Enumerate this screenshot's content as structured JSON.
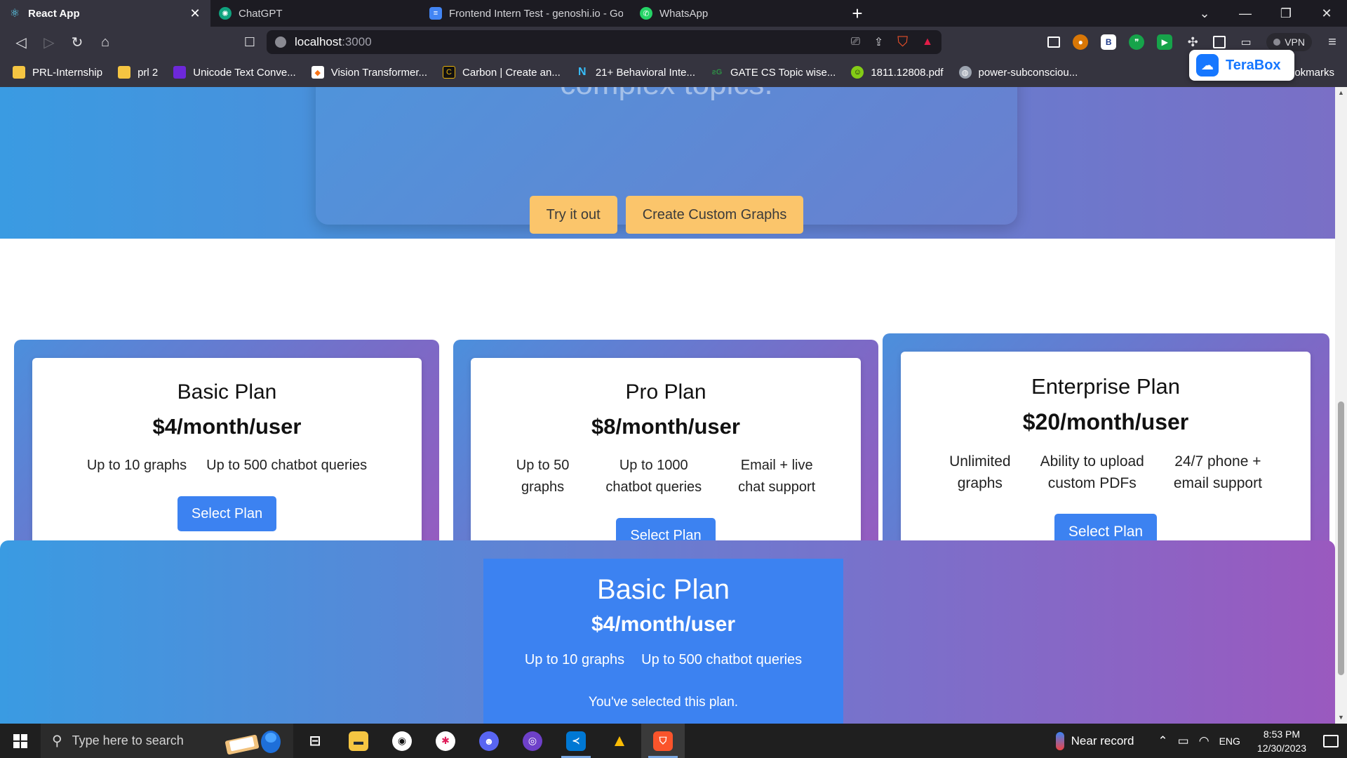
{
  "browser": {
    "tabs": [
      {
        "label": "React App",
        "icon": "react-icon",
        "color": "#61dafb",
        "active": true
      },
      {
        "label": "ChatGPT",
        "icon": "chatgpt-icon",
        "color": "#10a37f",
        "active": false
      },
      {
        "label": "Frontend Intern Test - genoshi.io - Goo",
        "icon": "google-docs-icon",
        "color": "#4285f4",
        "active": false
      },
      {
        "label": "WhatsApp",
        "icon": "whatsapp-icon",
        "color": "#25d366",
        "active": false
      }
    ],
    "url_host": "localhost",
    "url_port": ":3000",
    "vpn_label": "VPN",
    "bookmarks": [
      {
        "label": "PRL-Internship",
        "icon": "folder-icon",
        "color": "#f5c542"
      },
      {
        "label": "prl 2",
        "icon": "folder-icon",
        "color": "#f5c542"
      },
      {
        "label": "Unicode Text Conve...",
        "icon": "unicode-icon",
        "color": "#6d28d9"
      },
      {
        "label": "Vision Transformer...",
        "icon": "vision-icon",
        "color": "#f97316"
      },
      {
        "label": "Carbon | Create an...",
        "icon": "carbon-icon",
        "color": "#111111"
      },
      {
        "label": "21+ Behavioral Inte...",
        "icon": "n-icon",
        "color": "#38bdf8"
      },
      {
        "label": "GATE CS Topic wise...",
        "icon": "gfg-icon",
        "color": "#2f8d46"
      },
      {
        "label": "1811.12808.pdf",
        "icon": "pdf-icon",
        "color": "#84cc16"
      },
      {
        "label": "power-subconsciou...",
        "icon": "globe-icon",
        "color": "#9ca3af"
      }
    ],
    "bookmarks_end": "okmarks",
    "terabox_label": "TeraBox"
  },
  "hero": {
    "text": "complex topics.",
    "buttons": [
      "Try it out",
      "Create Custom Graphs"
    ]
  },
  "plans": [
    {
      "title": "Basic Plan",
      "price": "$4/month/user",
      "features": [
        "Up to 10 graphs",
        "Up to 500 chatbot queries"
      ],
      "button": "Select Plan"
    },
    {
      "title": "Pro Plan",
      "price": "$8/month/user",
      "features": [
        "Up to 50\ngraphs",
        "Up to 1000\nchatbot queries",
        "Email + live\nchat support"
      ],
      "button": "Select Plan"
    },
    {
      "title": "Enterprise Plan",
      "price": "$20/month/user",
      "features": [
        "Unlimited\ngraphs",
        "Ability to upload\ncustom PDFs",
        "24/7 phone +\nemail support"
      ],
      "button": "Select Plan"
    }
  ],
  "selected": {
    "title": "Basic Plan",
    "price": "$4/month/user",
    "features": [
      "Up to 10 graphs",
      "Up to 500 chatbot queries"
    ],
    "message": "You've selected this plan."
  },
  "taskbar": {
    "search_placeholder": "Type here to search",
    "weather": "Near record",
    "language": "ENG",
    "time": "8:53 PM",
    "date": "12/30/2023"
  },
  "colors": {
    "accent_button": "#3c82f1",
    "hero_button": "#fbc56b",
    "gradient_start": "#3a9be2",
    "gradient_end": "#9a59bf"
  }
}
